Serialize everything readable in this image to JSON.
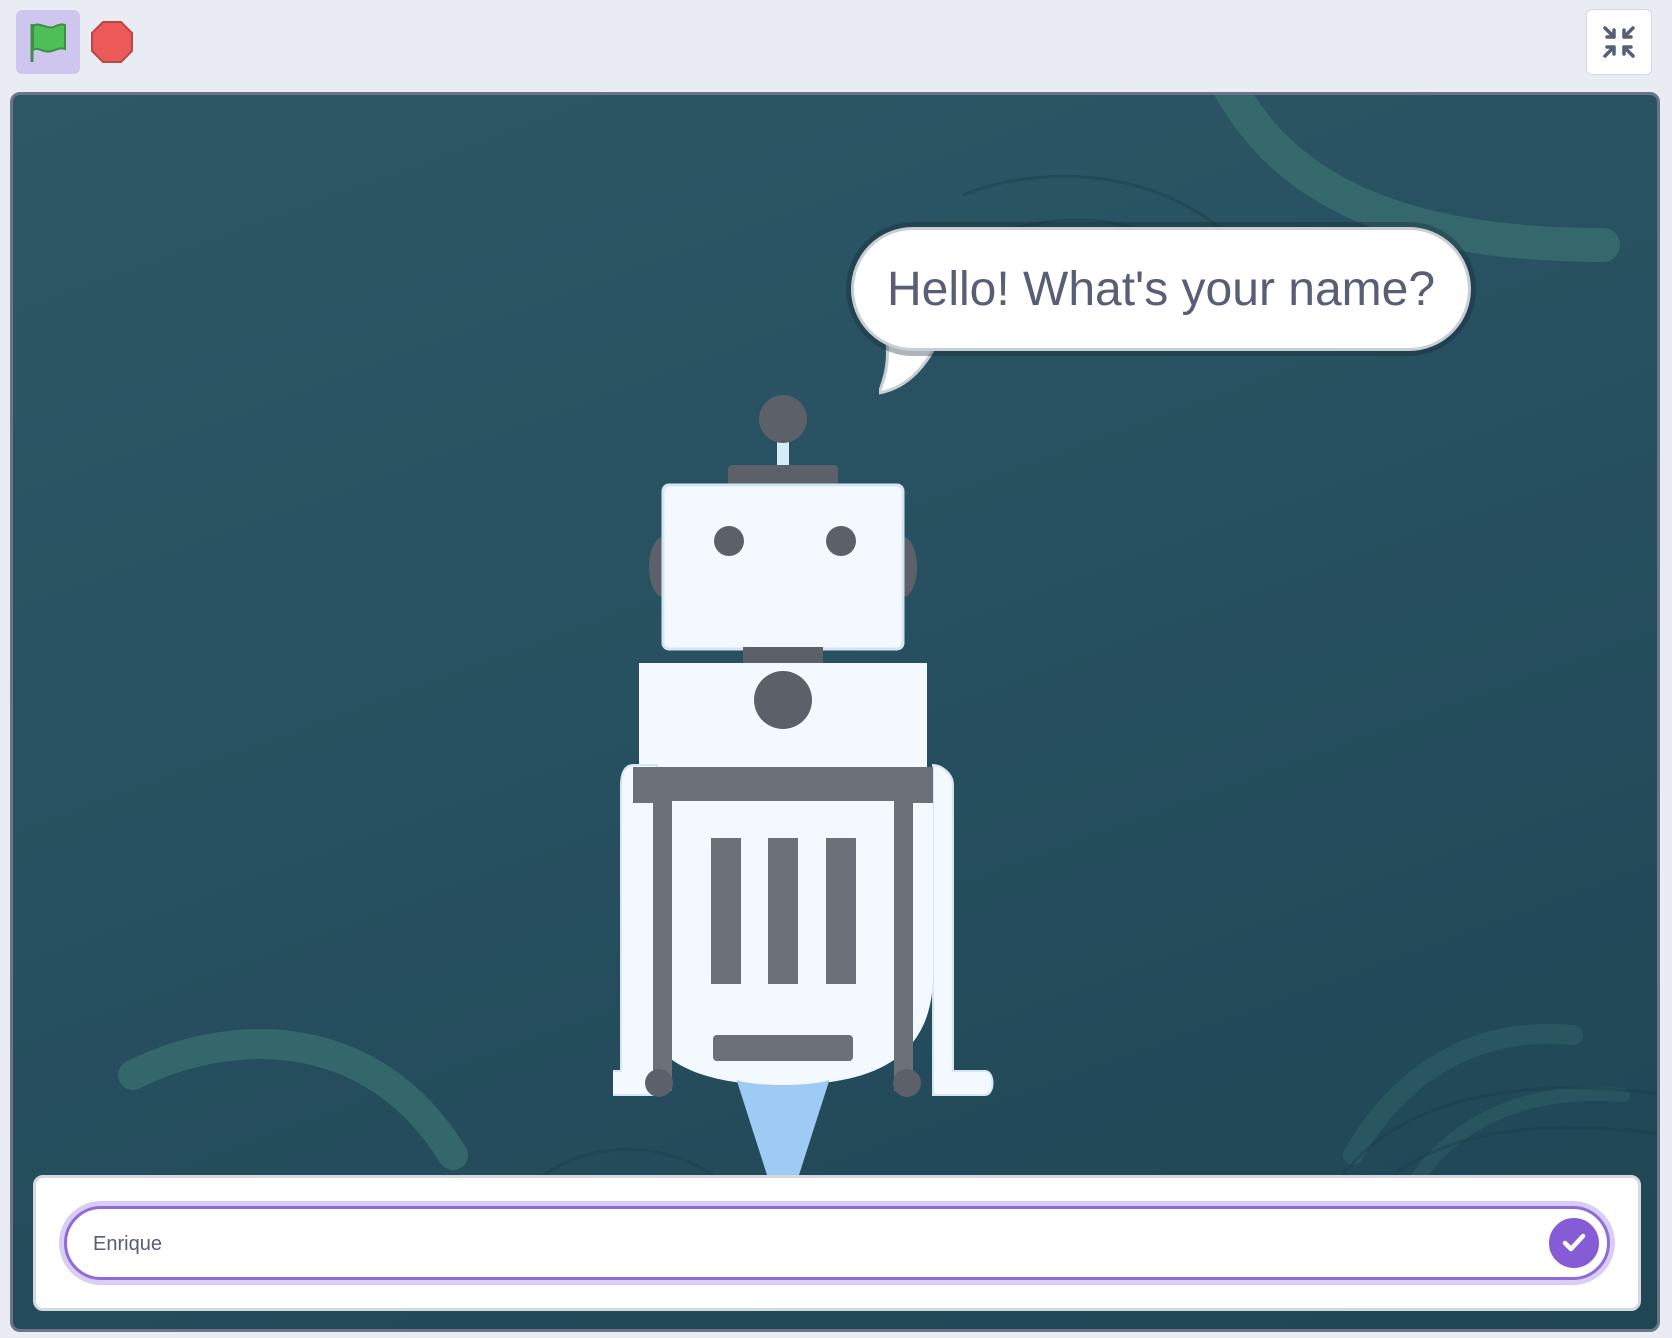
{
  "toolbar": {
    "green_flag": {
      "icon": "green-flag-icon"
    },
    "stop": {
      "icon": "stop-sign-icon"
    },
    "exit_fullscreen": {
      "icon": "exit-fullscreen-icon"
    }
  },
  "stage": {
    "speech_bubble": {
      "text": "Hello! What's your name?"
    },
    "sprite": {
      "name": "robot"
    }
  },
  "ask": {
    "input_value": "Enrique",
    "submit_icon": "checkmark-icon"
  },
  "colors": {
    "flag_bg": "#cfc6ef",
    "flag_green": "#4cbf56",
    "stop_red": "#ec5959",
    "accent_purple": "#855cd6",
    "stage_bg": "#275060"
  }
}
